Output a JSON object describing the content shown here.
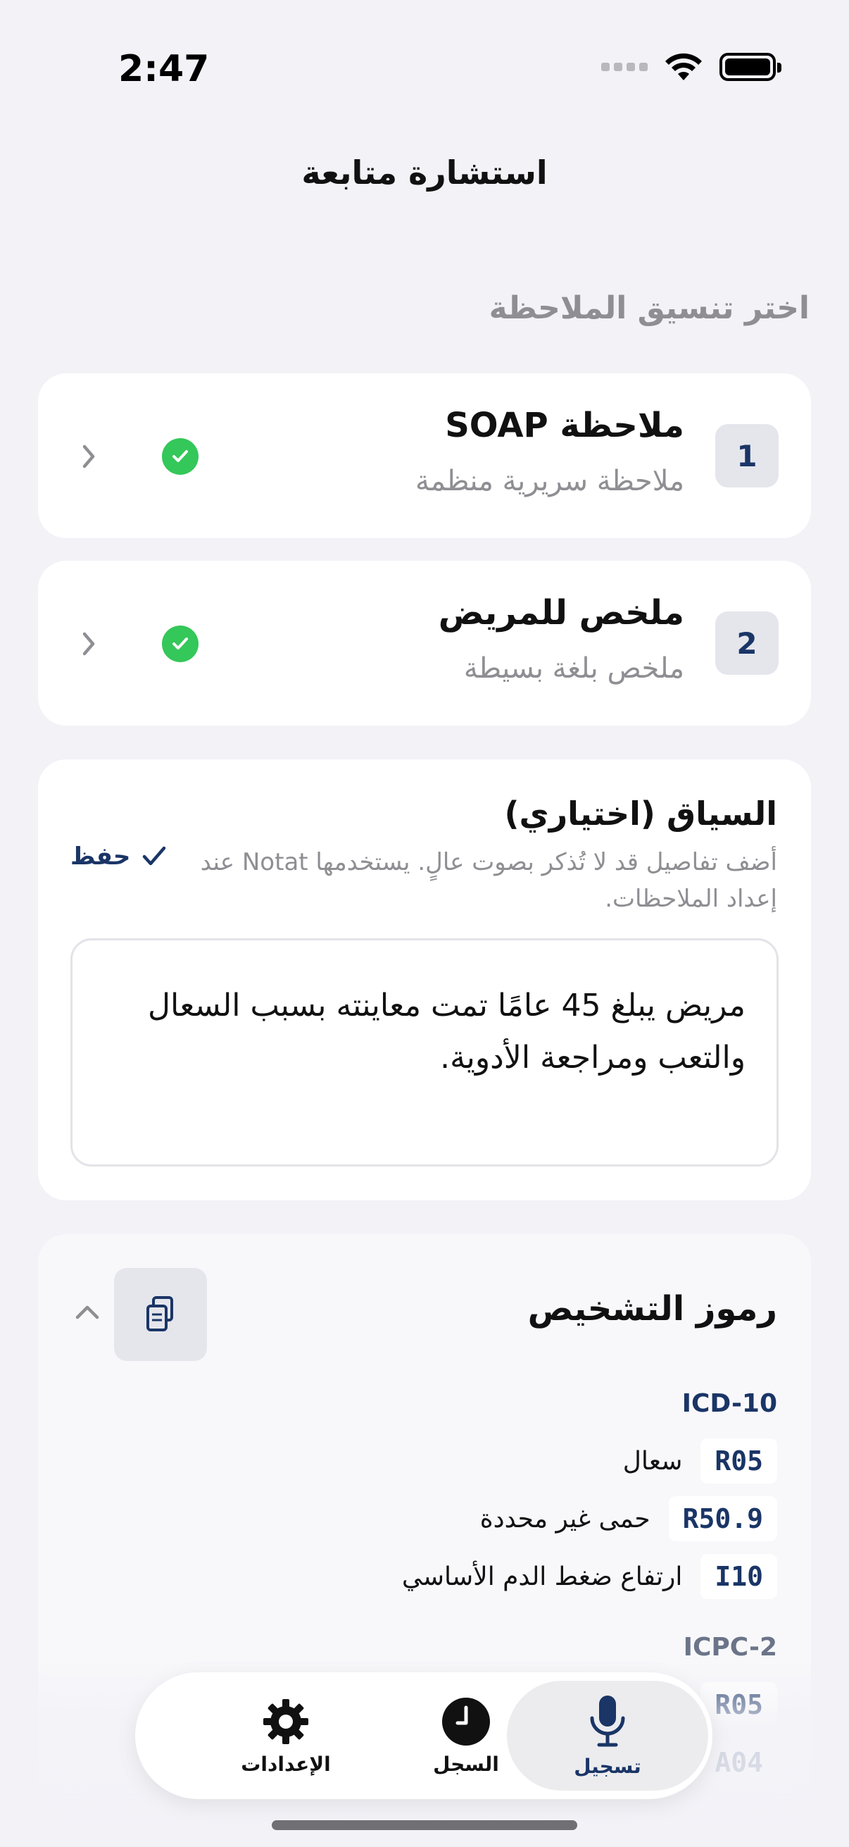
{
  "status_bar": {
    "time": "2:47"
  },
  "nav": {
    "title": "استشارة متابعة"
  },
  "formats": {
    "header": "اختر تنسيق الملاحظة",
    "items": [
      {
        "number": "1",
        "title": "ملاحظة SOAP",
        "subtitle": "ملاحظة سريرية منظمة"
      },
      {
        "number": "2",
        "title": "ملخص للمريض",
        "subtitle": "ملخص بلغة بسيطة"
      }
    ]
  },
  "context": {
    "title": "السياق (اختياري)",
    "description": "أضف تفاصيل قد لا تُذكر بصوت عالٍ. يستخدمها Notat عند إعداد الملاحظات.",
    "save_label": "حفظ",
    "text": "مريض يبلغ 45 عامًا تمت معاينته بسبب السعال والتعب ومراجعة الأدوية."
  },
  "diagnosis": {
    "title": "رموز التشخيص",
    "systems": [
      {
        "name": "ICD-10",
        "codes": [
          {
            "code": "R05",
            "description": "سعال"
          },
          {
            "code": "R50.9",
            "description": "حمى غير محددة"
          },
          {
            "code": "I10",
            "description": "ارتفاع ضغط الدم الأساسي"
          }
        ]
      },
      {
        "name": "ICPC-2",
        "codes": [
          {
            "code": "R05",
            "description": ""
          },
          {
            "code": "A04",
            "description": ""
          }
        ]
      }
    ]
  },
  "tab_bar": {
    "settings": "الإعدادات",
    "history": "السجل",
    "record": "تسجيل"
  },
  "colors": {
    "accent": "#1a3566",
    "success": "#34c759",
    "background": "#f2f2f7"
  }
}
